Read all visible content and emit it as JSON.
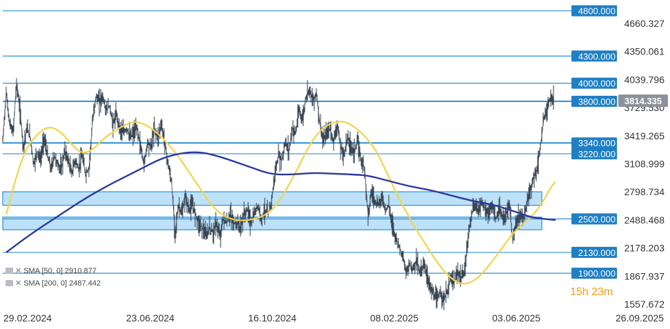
{
  "chart_data": {
    "type": "line",
    "y_ticks": [
      "4660.327",
      "4350.061",
      "4039.796",
      "3729.530",
      "3419.265",
      "3108.999",
      "2798.734",
      "2488.468",
      "2178.203",
      "1867.937",
      "1557.672"
    ],
    "x_ticks": [
      "29.02.2024",
      "23.06.2024",
      "16.10.2024",
      "08.02.2025",
      "03.06.2025",
      "26.09.2025"
    ],
    "ylim": [
      1557.672,
      4660.327
    ],
    "last_price": "3814.335",
    "price_levels": [
      "4800.000",
      "4300.000",
      "4000.000",
      "3800.000",
      "3340.000",
      "3220.000",
      "2500.000",
      "2130.000",
      "1900.000"
    ],
    "zones": [
      [
        2650,
        2800
      ],
      [
        2380,
        2520
      ]
    ],
    "series": [
      {
        "name": "SMA [50, 0]",
        "value": "2910.877",
        "color": "#f2d34a"
      },
      {
        "name": "SMA [200, 0]",
        "value": "2487.442",
        "color": "#2b3a9b"
      }
    ],
    "price_path": [
      [
        0,
        3350
      ],
      [
        5,
        3900
      ],
      [
        10,
        3550
      ],
      [
        15,
        3450
      ],
      [
        20,
        4000
      ],
      [
        25,
        3700
      ],
      [
        30,
        3300
      ],
      [
        35,
        3500
      ],
      [
        40,
        3400
      ],
      [
        45,
        3100
      ],
      [
        50,
        3250
      ],
      [
        55,
        3150
      ],
      [
        60,
        3400
      ],
      [
        65,
        3200
      ],
      [
        70,
        3050
      ],
      [
        75,
        3200
      ],
      [
        80,
        3100
      ],
      [
        85,
        3050
      ],
      [
        90,
        3250
      ],
      [
        95,
        3150
      ],
      [
        100,
        3000
      ],
      [
        105,
        3150
      ],
      [
        110,
        3050
      ],
      [
        115,
        3200
      ],
      [
        120,
        3000
      ],
      [
        125,
        3050
      ],
      [
        130,
        3550
      ],
      [
        135,
        3850
      ],
      [
        140,
        3800
      ],
      [
        145,
        3850
      ],
      [
        150,
        3700
      ],
      [
        155,
        3750
      ],
      [
        160,
        3550
      ],
      [
        165,
        3650
      ],
      [
        170,
        3500
      ],
      [
        175,
        3450
      ],
      [
        180,
        3500
      ],
      [
        185,
        3400
      ],
      [
        190,
        3450
      ],
      [
        195,
        3500
      ],
      [
        200,
        3300
      ],
      [
        205,
        3100
      ],
      [
        210,
        3350
      ],
      [
        215,
        3300
      ],
      [
        220,
        3500
      ],
      [
        225,
        3400
      ],
      [
        230,
        3550
      ],
      [
        235,
        3350
      ],
      [
        240,
        3100
      ],
      [
        245,
        2900
      ],
      [
        250,
        2350
      ],
      [
        255,
        2650
      ],
      [
        260,
        2550
      ],
      [
        265,
        2750
      ],
      [
        270,
        2600
      ],
      [
        275,
        2650
      ],
      [
        280,
        2550
      ],
      [
        285,
        2450
      ],
      [
        290,
        2400
      ],
      [
        295,
        2300
      ],
      [
        300,
        2400
      ],
      [
        305,
        2350
      ],
      [
        310,
        2450
      ],
      [
        315,
        2300
      ],
      [
        320,
        2500
      ],
      [
        325,
        2450
      ],
      [
        330,
        2550
      ],
      [
        335,
        2450
      ],
      [
        340,
        2450
      ],
      [
        345,
        2400
      ],
      [
        350,
        2550
      ],
      [
        355,
        2600
      ],
      [
        360,
        2450
      ],
      [
        365,
        2550
      ],
      [
        370,
        2650
      ],
      [
        375,
        2500
      ],
      [
        380,
        2600
      ],
      [
        385,
        2550
      ],
      [
        390,
        2700
      ],
      [
        395,
        3000
      ],
      [
        400,
        3200
      ],
      [
        405,
        3150
      ],
      [
        410,
        3350
      ],
      [
        415,
        3250
      ],
      [
        420,
        3500
      ],
      [
        425,
        3450
      ],
      [
        430,
        3700
      ],
      [
        435,
        3600
      ],
      [
        440,
        3850
      ],
      [
        445,
        3950
      ],
      [
        450,
        3800
      ],
      [
        455,
        3900
      ],
      [
        460,
        3550
      ],
      [
        465,
        3350
      ],
      [
        470,
        3450
      ],
      [
        475,
        3500
      ],
      [
        480,
        3350
      ],
      [
        485,
        3550
      ],
      [
        490,
        3300
      ],
      [
        495,
        3200
      ],
      [
        500,
        3400
      ],
      [
        505,
        3300
      ],
      [
        510,
        3250
      ],
      [
        515,
        3350
      ],
      [
        520,
        3150
      ],
      [
        525,
        3050
      ],
      [
        530,
        2550
      ],
      [
        535,
        2800
      ],
      [
        540,
        2700
      ],
      [
        545,
        2650
      ],
      [
        550,
        2750
      ],
      [
        555,
        2600
      ],
      [
        560,
        2650
      ],
      [
        565,
        2450
      ],
      [
        570,
        2300
      ],
      [
        575,
        2200
      ],
      [
        580,
        2100
      ],
      [
        585,
        1900
      ],
      [
        590,
        2000
      ],
      [
        595,
        1950
      ],
      [
        600,
        2050
      ],
      [
        605,
        1900
      ],
      [
        610,
        2000
      ],
      [
        615,
        1900
      ],
      [
        620,
        1750
      ],
      [
        625,
        1650
      ],
      [
        630,
        1600
      ],
      [
        635,
        1700
      ],
      [
        640,
        1600
      ],
      [
        645,
        1700
      ],
      [
        650,
        1850
      ],
      [
        655,
        1800
      ],
      [
        660,
        1900
      ],
      [
        665,
        1850
      ],
      [
        670,
        1900
      ],
      [
        675,
        2300
      ],
      [
        680,
        2550
      ],
      [
        685,
        2650
      ],
      [
        690,
        2600
      ],
      [
        695,
        2700
      ],
      [
        700,
        2600
      ],
      [
        705,
        2550
      ],
      [
        710,
        2650
      ],
      [
        715,
        2500
      ],
      [
        720,
        2600
      ],
      [
        725,
        2500
      ],
      [
        730,
        2550
      ],
      [
        735,
        2650
      ],
      [
        740,
        2250
      ],
      [
        745,
        2450
      ],
      [
        750,
        2550
      ],
      [
        755,
        2500
      ],
      [
        760,
        2650
      ],
      [
        765,
        2800
      ],
      [
        770,
        2950
      ],
      [
        775,
        3050
      ],
      [
        780,
        3300
      ],
      [
        785,
        3600
      ],
      [
        790,
        3750
      ],
      [
        795,
        3850
      ],
      [
        800,
        3814
      ]
    ],
    "sma50_path": [
      [
        5,
        2550
      ],
      [
        30,
        3250
      ],
      [
        55,
        3480
      ],
      [
        70,
        3520
      ],
      [
        85,
        3460
      ],
      [
        100,
        3320
      ],
      [
        115,
        3220
      ],
      [
        130,
        3260
      ],
      [
        145,
        3380
      ],
      [
        160,
        3460
      ],
      [
        175,
        3530
      ],
      [
        190,
        3580
      ],
      [
        205,
        3550
      ],
      [
        220,
        3480
      ],
      [
        240,
        3330
      ],
      [
        255,
        3190
      ],
      [
        270,
        3020
      ],
      [
        285,
        2850
      ],
      [
        300,
        2680
      ],
      [
        315,
        2560
      ],
      [
        330,
        2500
      ],
      [
        345,
        2480
      ],
      [
        360,
        2490
      ],
      [
        375,
        2520
      ],
      [
        390,
        2590
      ],
      [
        405,
        2740
      ],
      [
        420,
        2940
      ],
      [
        435,
        3170
      ],
      [
        450,
        3380
      ],
      [
        465,
        3510
      ],
      [
        480,
        3570
      ],
      [
        495,
        3580
      ],
      [
        510,
        3520
      ],
      [
        525,
        3420
      ],
      [
        540,
        3280
      ],
      [
        555,
        3050
      ],
      [
        570,
        2800
      ],
      [
        585,
        2580
      ],
      [
        600,
        2380
      ],
      [
        615,
        2200
      ],
      [
        630,
        2020
      ],
      [
        645,
        1880
      ],
      [
        660,
        1790
      ],
      [
        675,
        1780
      ],
      [
        690,
        1850
      ],
      [
        705,
        1980
      ],
      [
        720,
        2130
      ],
      [
        735,
        2290
      ],
      [
        750,
        2420
      ],
      [
        765,
        2510
      ],
      [
        780,
        2640
      ],
      [
        795,
        2850
      ],
      [
        802,
        2911
      ]
    ],
    "sma200_path": [
      [
        5,
        2130
      ],
      [
        40,
        2330
      ],
      [
        80,
        2530
      ],
      [
        120,
        2730
      ],
      [
        160,
        2900
      ],
      [
        200,
        3050
      ],
      [
        230,
        3170
      ],
      [
        260,
        3230
      ],
      [
        285,
        3240
      ],
      [
        305,
        3210
      ],
      [
        330,
        3150
      ],
      [
        360,
        3070
      ],
      [
        390,
        2990
      ],
      [
        420,
        2990
      ],
      [
        450,
        3010
      ],
      [
        480,
        3000
      ],
      [
        510,
        2990
      ],
      [
        530,
        2980
      ],
      [
        560,
        2920
      ],
      [
        590,
        2860
      ],
      [
        620,
        2820
      ],
      [
        650,
        2760
      ],
      [
        680,
        2700
      ],
      [
        710,
        2660
      ],
      [
        740,
        2590
      ],
      [
        765,
        2520
      ],
      [
        785,
        2500
      ],
      [
        802,
        2487
      ]
    ]
  },
  "legend": {
    "sma50": "SMA [50, 0]  2910.877",
    "sma200": "SMA [200, 0]  2487.442"
  },
  "countdown": "15h 23m"
}
